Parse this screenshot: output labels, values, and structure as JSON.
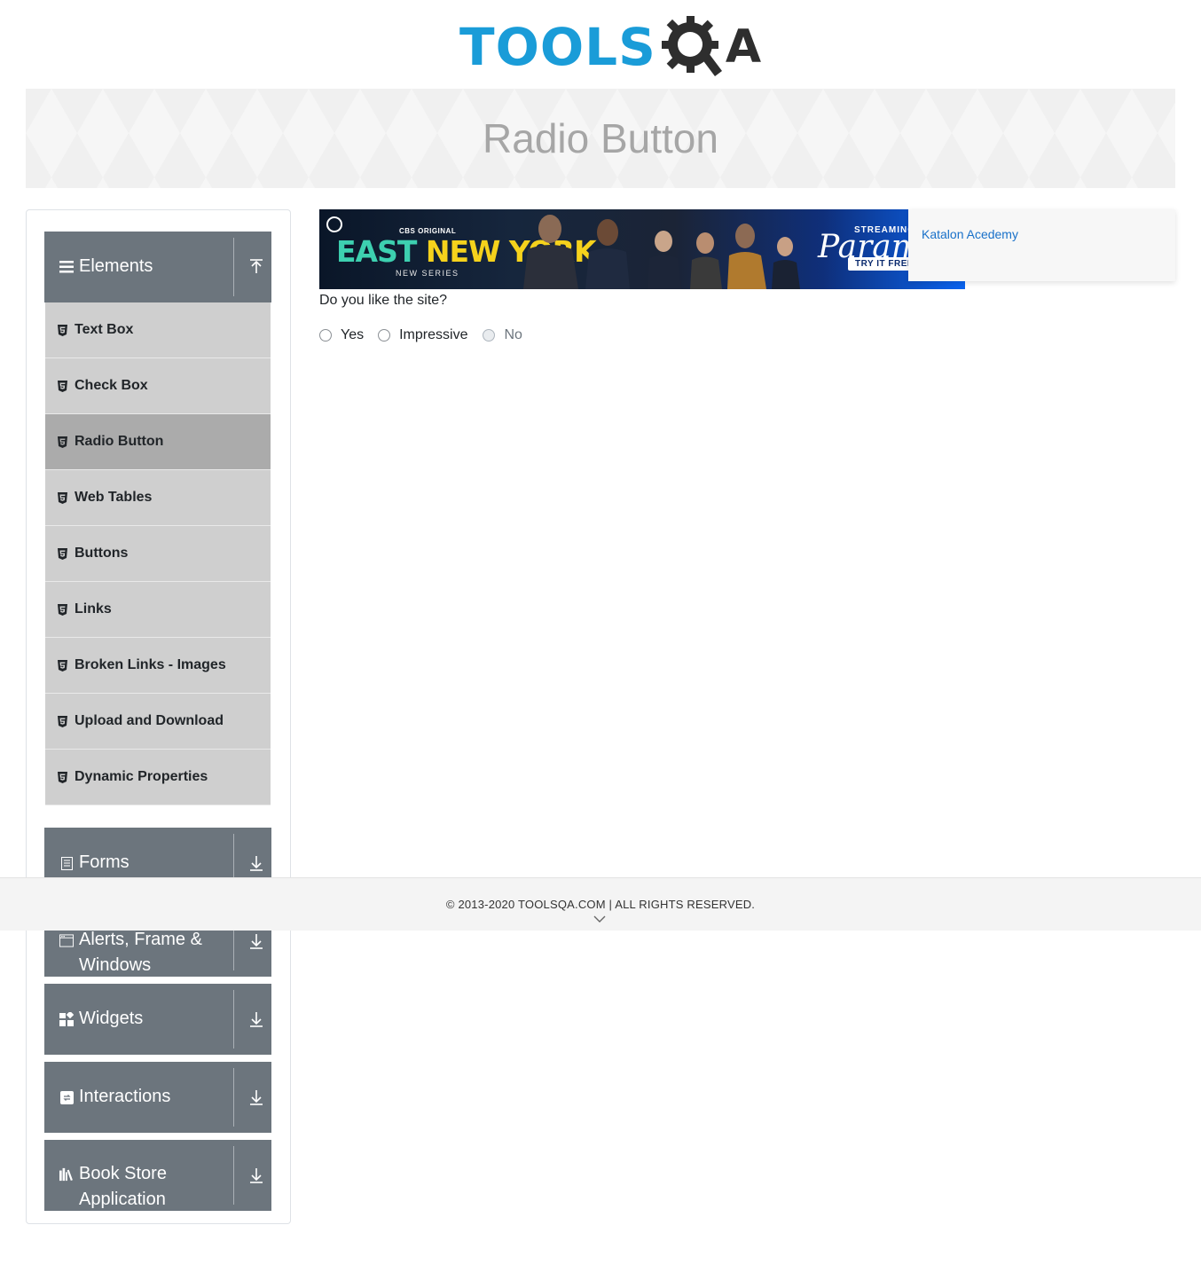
{
  "logo": {
    "text_blue": "TOOLS",
    "text_q": "Q",
    "text_a": "A"
  },
  "banner": {
    "title": "Radio Button"
  },
  "sidebar": {
    "groups": [
      {
        "label": "Elements",
        "icon": "hamburger-icon",
        "state": "expanded"
      },
      {
        "label": "Forms",
        "icon": "form-icon",
        "state": "collapsed"
      },
      {
        "label": "Alerts, Frame & Windows",
        "icon": "window-icon",
        "state": "collapsed"
      },
      {
        "label": "Widgets",
        "icon": "widgets-icon",
        "state": "collapsed"
      },
      {
        "label": "Interactions",
        "icon": "interactions-icon",
        "state": "collapsed"
      },
      {
        "label": "Book Store Application",
        "icon": "books-icon",
        "state": "collapsed"
      }
    ],
    "items": [
      {
        "label": "Text Box"
      },
      {
        "label": "Check Box"
      },
      {
        "label": "Radio Button",
        "active": true
      },
      {
        "label": "Web Tables"
      },
      {
        "label": "Buttons"
      },
      {
        "label": "Links"
      },
      {
        "label": "Broken Links - Images"
      },
      {
        "label": "Upload and Download"
      },
      {
        "label": "Dynamic Properties"
      }
    ]
  },
  "ad": {
    "tag": "CBS ORIGINAL",
    "title_part1": "EAST",
    "title_part2": "NEW YORK",
    "subtitle": "NEW SERIES",
    "streaming": "STREAMING",
    "brand": "Paramount",
    "cta": "TRY IT FREE"
  },
  "side_ad": {
    "link": "Katalon Acedemy"
  },
  "question": "Do you like the site?",
  "radios": [
    {
      "label": "Yes",
      "disabled": false,
      "checked": false
    },
    {
      "label": "Impressive",
      "disabled": false,
      "checked": false
    },
    {
      "label": "No",
      "disabled": true,
      "checked": false
    }
  ],
  "footer": {
    "text": "© 2013-2020 TOOLSQA.COM | ALL RIGHTS RESERVED."
  },
  "colors": {
    "brand_blue": "#1a9cd8",
    "group_bg": "#6c757d",
    "item_bg": "#cfcfcf",
    "item_active": "#ababab"
  }
}
